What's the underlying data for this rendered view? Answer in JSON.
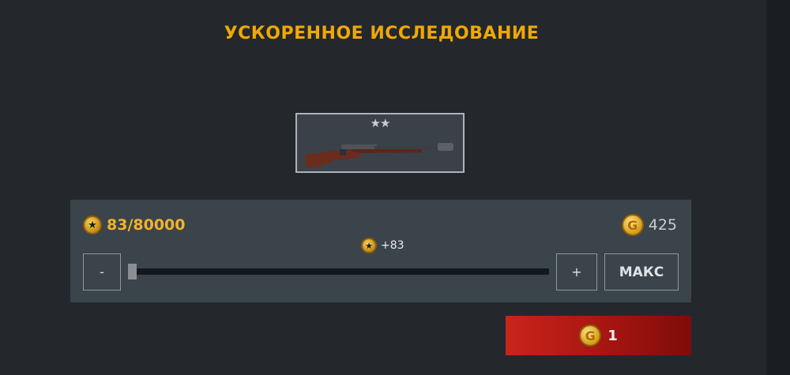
{
  "title": "УСКОРЕННОЕ ИССЛЕДОВАНИЕ",
  "item": {
    "stars": "★★",
    "icon": "rifle-icon"
  },
  "xp": {
    "current_total": "83/80000",
    "icon": "star-coin-icon"
  },
  "gold": {
    "balance": "425",
    "icon": "gold-coin-icon"
  },
  "slider": {
    "gain_label": "+83",
    "value_fraction": 0.0
  },
  "buttons": {
    "minus": "-",
    "plus": "+",
    "max": "МАКС"
  },
  "buy": {
    "cost": "1",
    "icon": "gold-coin-icon"
  },
  "colors": {
    "title": "#f0a800",
    "xp": "#f0b429",
    "buy_start": "#c9241b",
    "buy_end": "#7d0c0a"
  }
}
